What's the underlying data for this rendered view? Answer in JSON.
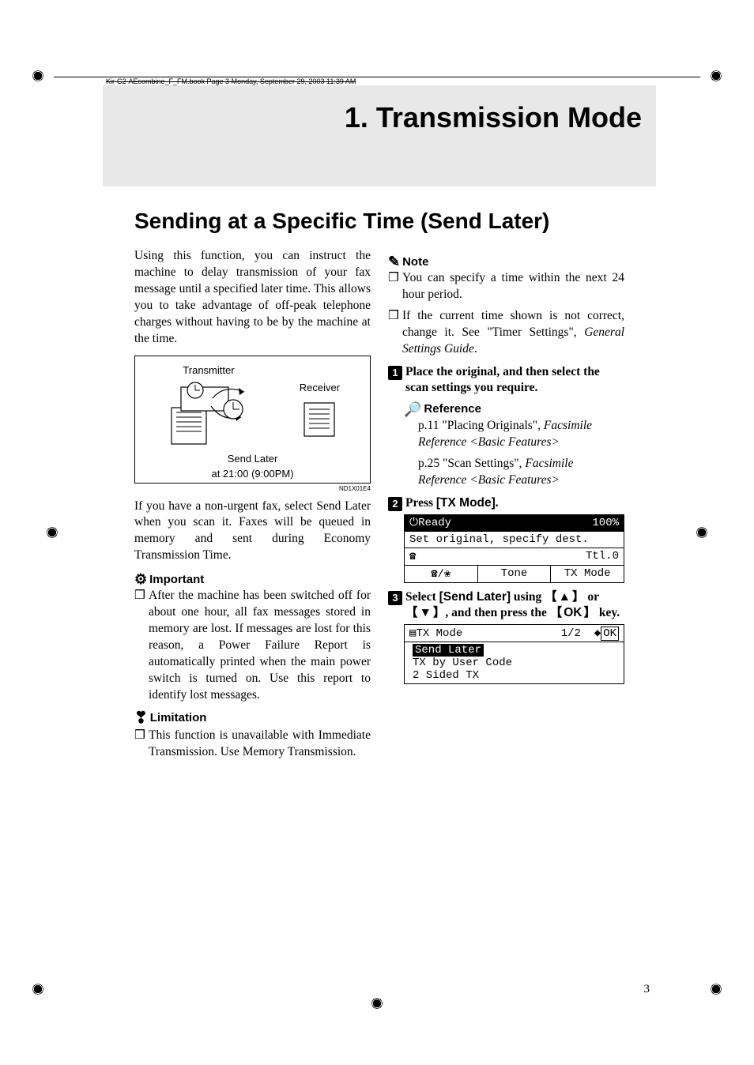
{
  "header_path": "Kir-C2-AEcombine_F_FM.book  Page 3  Monday, September 29, 2003  11:39 AM",
  "title": "1. Transmission Mode",
  "subtitle": "Sending at a Specific Time (Send Later)",
  "left": {
    "p1": "Using this function, you can instruct the machine to delay transmission of your fax message until a specified later time. This allows you to take advantage of off-peak telephone charges without having to be by the machine at the time.",
    "diagram": {
      "transmitter": "Transmitter",
      "receiver": "Receiver",
      "caption1": "Send Later",
      "caption2": "at 21:00 (9:00PM)"
    },
    "figref": "ND1X01E4",
    "p2": "If you have a non-urgent fax, select Send Later when you scan it. Faxes will be queued in memory and sent during Economy Transmission Time.",
    "important_label": "Important",
    "important_text": "After the machine has been switched off for about one hour, all fax messages stored in memory are lost. If messages are lost for this reason, a Power Failure Report is automatically printed when the main power switch is turned on. Use this report to identify lost messages.",
    "limitation_label": "Limitation",
    "limitation_text": "This function is unavailable with Immediate Transmission. Use Memory Transmission."
  },
  "right": {
    "note_label": "Note",
    "note1": "You can specify a time within the next 24 hour period.",
    "note2_a": "If the current time shown is not correct, change it. See \"Timer Settings\", ",
    "note2_b": "General Settings Guide",
    "note2_c": ".",
    "step1": "Place the original, and then select the scan settings you require.",
    "reference_label": "Reference",
    "ref1_a": "p.11 \"Placing Originals\", ",
    "ref1_b": "Facsimile Reference <Basic Features>",
    "ref2_a": "p.25 \"Scan Settings\", ",
    "ref2_b": "Facsimile Reference <Basic Features>",
    "step2_a": "Press ",
    "step2_b": "[TX Mode]",
    "step2_c": ".",
    "lcd1": {
      "ready": "Ready",
      "pct": "100%",
      "line2": "Set original, specify dest.",
      "ttl": "Ttl.0",
      "tone": "Tone",
      "txmode": "TX Mode"
    },
    "step3_a": "Select ",
    "step3_b": "[Send Later]",
    "step3_c": " using ",
    "step3_d": " or ",
    "step3_e": ", and then press the ",
    "step3_f": " key.",
    "key_up": "▲",
    "key_down": "▼",
    "key_ok": "OK",
    "lcd2": {
      "title": "TX Mode",
      "page": "1/2",
      "ok": "OK",
      "item1": "Send Later",
      "item2": "TX by User Code",
      "item3": "2 Sided TX"
    }
  },
  "page_number": "3"
}
